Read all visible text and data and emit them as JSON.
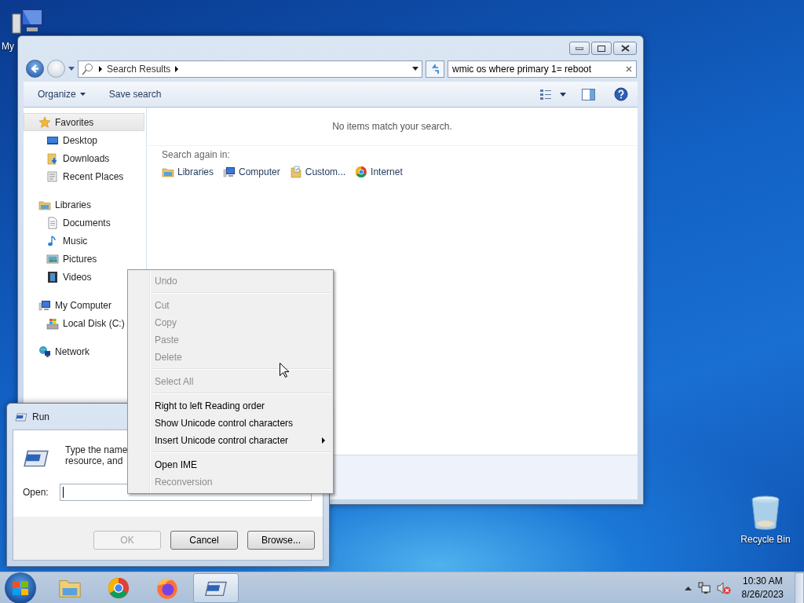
{
  "desktop_icons": [
    {
      "kind": "computer",
      "label": "My"
    },
    {
      "kind": "recycle",
      "label": "Recycle Bin"
    }
  ],
  "explorer": {
    "address": {
      "crumb": "Search Results"
    },
    "search": {
      "value": "wmic os where primary 1= reboot"
    },
    "toolbar": [
      "Organize",
      "Save search"
    ],
    "sidebar": [
      {
        "kind": "star",
        "label": "Favorites",
        "selected": true,
        "children": [
          {
            "kind": "desktop",
            "label": "Desktop"
          },
          {
            "kind": "downloads",
            "label": "Downloads"
          },
          {
            "kind": "recent",
            "label": "Recent Places"
          }
        ]
      },
      {
        "kind": "libraries",
        "label": "Libraries",
        "selected": false,
        "children": [
          {
            "kind": "document",
            "label": "Documents"
          },
          {
            "kind": "music",
            "label": "Music"
          },
          {
            "kind": "pictures",
            "label": "Pictures"
          },
          {
            "kind": "videos",
            "label": "Videos"
          }
        ]
      },
      {
        "kind": "computer",
        "label": "My Computer",
        "selected": false,
        "children": [
          {
            "kind": "disk",
            "label": "Local Disk (C:)"
          }
        ]
      },
      {
        "kind": "network",
        "label": "Network",
        "selected": false
      }
    ],
    "message": "No items match your search.",
    "search_again": {
      "label": "Search again in:",
      "items": [
        {
          "kind": "libraries",
          "label": "Libraries"
        },
        {
          "kind": "computer",
          "label": "Computer"
        },
        {
          "kind": "custom",
          "label": "Custom..."
        },
        {
          "kind": "chrome",
          "label": "Internet"
        }
      ]
    }
  },
  "run_dialog": {
    "title": "Run",
    "prompt_lines": [
      "Type the name",
      "resource, and"
    ],
    "open_label": "Open:",
    "buttons": [
      {
        "label": "OK",
        "disabled": true
      },
      {
        "label": "Cancel",
        "disabled": false
      },
      {
        "label": "Browse...",
        "disabled": false
      }
    ]
  },
  "context_menu": {
    "items": [
      {
        "kind": "item",
        "label": "Undo",
        "disabled": true,
        "has_submenu": false
      },
      {
        "kind": "separator"
      },
      {
        "kind": "item",
        "label": "Cut",
        "disabled": true,
        "has_submenu": false
      },
      {
        "kind": "item",
        "label": "Copy",
        "disabled": true,
        "has_submenu": false
      },
      {
        "kind": "item",
        "label": "Paste",
        "disabled": true,
        "has_submenu": false
      },
      {
        "kind": "item",
        "label": "Delete",
        "disabled": true,
        "has_submenu": false
      },
      {
        "kind": "separator"
      },
      {
        "kind": "item",
        "label": "Select All",
        "disabled": true,
        "has_submenu": false
      },
      {
        "kind": "separator"
      },
      {
        "kind": "item",
        "label": "Right to left Reading order",
        "disabled": false,
        "has_submenu": false
      },
      {
        "kind": "item",
        "label": "Show Unicode control characters",
        "disabled": false,
        "has_submenu": false
      },
      {
        "kind": "item",
        "label": "Insert Unicode control character",
        "disabled": false,
        "has_submenu": true
      },
      {
        "kind": "separator"
      },
      {
        "kind": "item",
        "label": "Open IME",
        "disabled": false,
        "has_submenu": false
      },
      {
        "kind": "item",
        "label": "Reconversion",
        "disabled": true,
        "has_submenu": false
      }
    ]
  },
  "taskbar": {
    "apps": [
      {
        "kind": "explorer",
        "selected": false
      },
      {
        "kind": "chrome",
        "selected": false
      },
      {
        "kind": "firefox",
        "selected": false
      },
      {
        "kind": "run",
        "selected": true
      }
    ],
    "clock": {
      "time": "10:30 AM",
      "date": "8/26/2023"
    }
  }
}
